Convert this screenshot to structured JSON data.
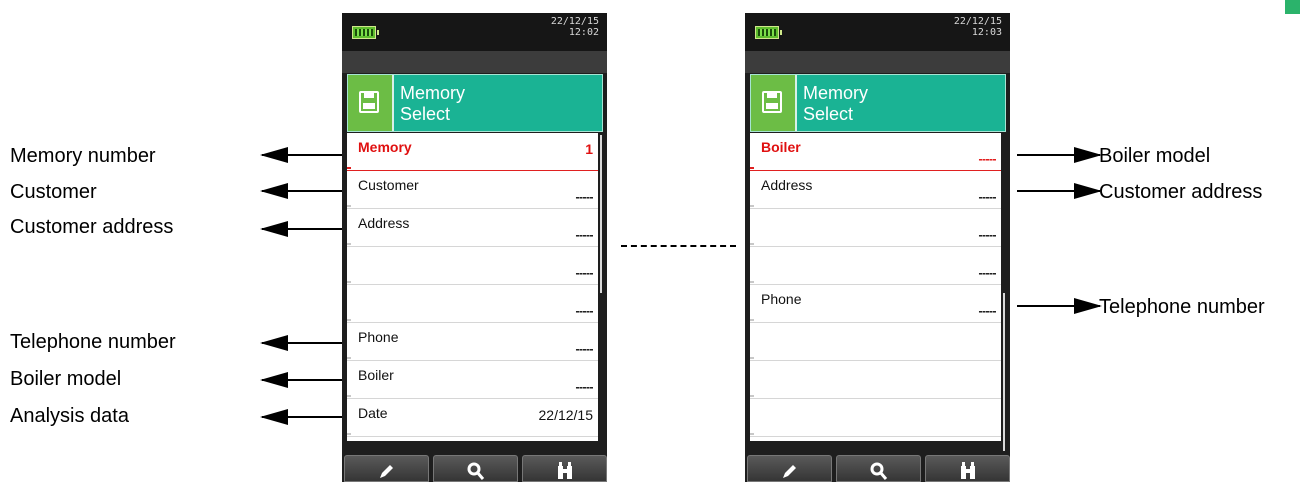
{
  "left_labels": [
    {
      "text": "Memory number"
    },
    {
      "text": "Customer"
    },
    {
      "text": "Customer address"
    },
    {
      "text": "Telephone number"
    },
    {
      "text": "Boiler model"
    },
    {
      "text": "Analysis data"
    }
  ],
  "right_labels": [
    {
      "text": "Boiler model"
    },
    {
      "text": "Customer address"
    },
    {
      "text": "Telephone number"
    }
  ],
  "screen1": {
    "date": "22/12/15",
    "time": "12:02",
    "title_line1": "Memory",
    "title_line2": "Select",
    "icon": "floppy-disk-icon",
    "rows": [
      {
        "label": "Memory",
        "value": "1",
        "selected": true
      },
      {
        "label": "Customer",
        "value": "-----"
      },
      {
        "label": "Address",
        "value": "-----"
      },
      {
        "label": "",
        "value": "-----"
      },
      {
        "label": "",
        "value": "-----"
      },
      {
        "label": "Phone",
        "value": "-----"
      },
      {
        "label": "Boiler",
        "value": "-----"
      },
      {
        "label": "Date",
        "value": "22/12/15"
      }
    ],
    "toolbar": [
      "pencil-icon",
      "magnifier-icon",
      "binoculars-icon"
    ]
  },
  "screen2": {
    "date": "22/12/15",
    "time": "12:03",
    "title_line1": "Memory",
    "title_line2": "Select",
    "icon": "floppy-disk-icon",
    "rows": [
      {
        "label": "Boiler",
        "value": "-----",
        "selected": true
      },
      {
        "label": "Address",
        "value": "-----"
      },
      {
        "label": "",
        "value": "-----"
      },
      {
        "label": "",
        "value": "-----"
      },
      {
        "label": "Phone",
        "value": "-----"
      },
      {
        "label": "",
        "value": ""
      },
      {
        "label": "",
        "value": ""
      },
      {
        "label": "",
        "value": ""
      }
    ],
    "toolbar": [
      "pencil-icon",
      "magnifier-icon",
      "binoculars-icon"
    ]
  },
  "colors": {
    "header": "#1ab394",
    "icon_bg": "#6cbd45",
    "selected": "#e01010"
  }
}
